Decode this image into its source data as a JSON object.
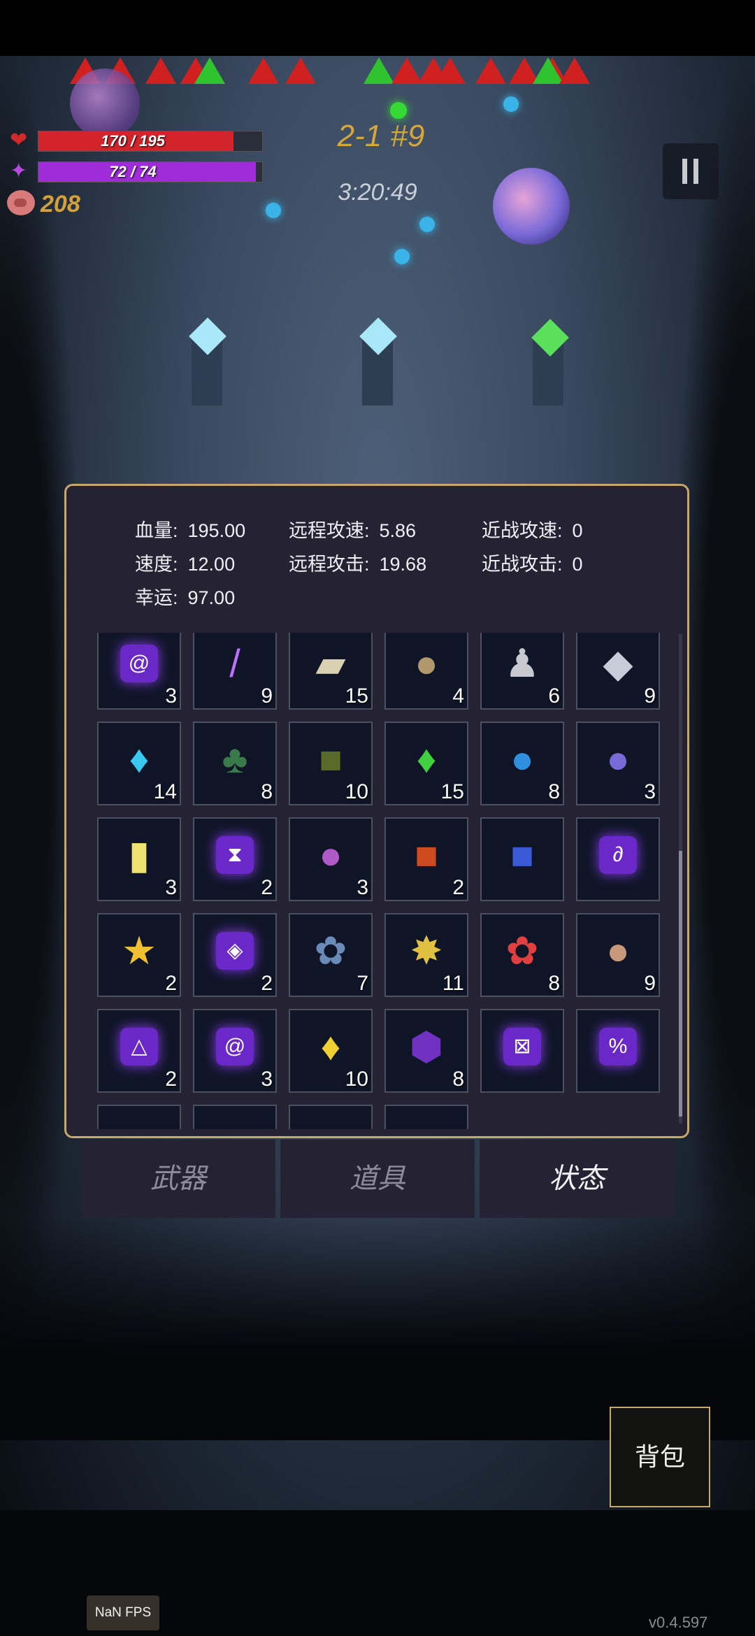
{
  "hud": {
    "hp_text": "170 / 195",
    "hp_fraction": 0.872,
    "mp_text": "72 / 74",
    "mp_fraction": 0.973,
    "coins": "208",
    "level": "2-1 #9",
    "timer": "3:20:49",
    "pause_icon": "pause-icon"
  },
  "stats": {
    "hp_label": "血量:",
    "hp_value": "195.00",
    "ranged_speed_label": "远程攻速:",
    "ranged_speed_value": "5.86",
    "melee_speed_label": "近战攻速:",
    "melee_speed_value": "0",
    "speed_label": "速度:",
    "speed_value": "12.00",
    "ranged_atk_label": "远程攻击:",
    "ranged_atk_value": "19.68",
    "melee_atk_label": "近战攻击:",
    "melee_atk_value": "0",
    "luck_label": "幸运:",
    "luck_value": "97.00"
  },
  "items": [
    {
      "icon": "swirl-rune-icon",
      "count": "3"
    },
    {
      "icon": "wand-icon",
      "count": "9"
    },
    {
      "icon": "ore-chunks-icon",
      "count": "15"
    },
    {
      "icon": "egg-icon",
      "count": "4"
    },
    {
      "icon": "ghost-statue-icon",
      "count": "6"
    },
    {
      "icon": "silver-ore-icon",
      "count": "9"
    },
    {
      "icon": "cyan-crystal-icon",
      "count": "14"
    },
    {
      "icon": "clover-icon",
      "count": "8"
    },
    {
      "icon": "skull-book-icon",
      "count": "10"
    },
    {
      "icon": "green-crystal-icon",
      "count": "15"
    },
    {
      "icon": "water-drop-icon",
      "count": "8"
    },
    {
      "icon": "rainbow-orb-icon",
      "count": "3"
    },
    {
      "icon": "hourglass-card-icon",
      "count": "3"
    },
    {
      "icon": "hourglass-rune-icon",
      "count": "2"
    },
    {
      "icon": "purple-slime-icon",
      "count": "3"
    },
    {
      "icon": "sun-book-icon",
      "count": "2"
    },
    {
      "icon": "triangle-book-icon",
      "count": ""
    },
    {
      "icon": "curve-rune-icon",
      "count": ""
    },
    {
      "icon": "star-trophy-icon",
      "count": "2"
    },
    {
      "icon": "eye-rune-icon",
      "count": "2"
    },
    {
      "icon": "blue-flower-icon",
      "count": "7"
    },
    {
      "icon": "gold-star-crystal-icon",
      "count": "11"
    },
    {
      "icon": "red-flowers-icon",
      "count": "8"
    },
    {
      "icon": "pouch-icon",
      "count": "9"
    },
    {
      "icon": "triangle-rune-icon",
      "count": "2"
    },
    {
      "icon": "spiral-rune-icon",
      "count": "3"
    },
    {
      "icon": "yellow-crystal-icon",
      "count": "10"
    },
    {
      "icon": "purple-snail-icon",
      "count": "8"
    },
    {
      "icon": "cross-rune-icon",
      "count": ""
    },
    {
      "icon": "percent-rune-icon",
      "count": ""
    },
    {
      "icon": "white-item-icon",
      "count": ""
    },
    {
      "icon": "gray-item-icon",
      "count": ""
    },
    {
      "icon": "orange-item-icon",
      "count": ""
    },
    {
      "icon": "quill-item-icon",
      "count": ""
    }
  ],
  "tabs": {
    "weapons": "武器",
    "props": "道具",
    "status": "状态"
  },
  "bag_label": "背包",
  "fps": "NaN FPS",
  "version": "v0.4.597",
  "colors": {
    "hp": "#d4242b",
    "mp": "#a02bd8",
    "gold": "#c8a86a",
    "rune": "#6a28c8"
  }
}
